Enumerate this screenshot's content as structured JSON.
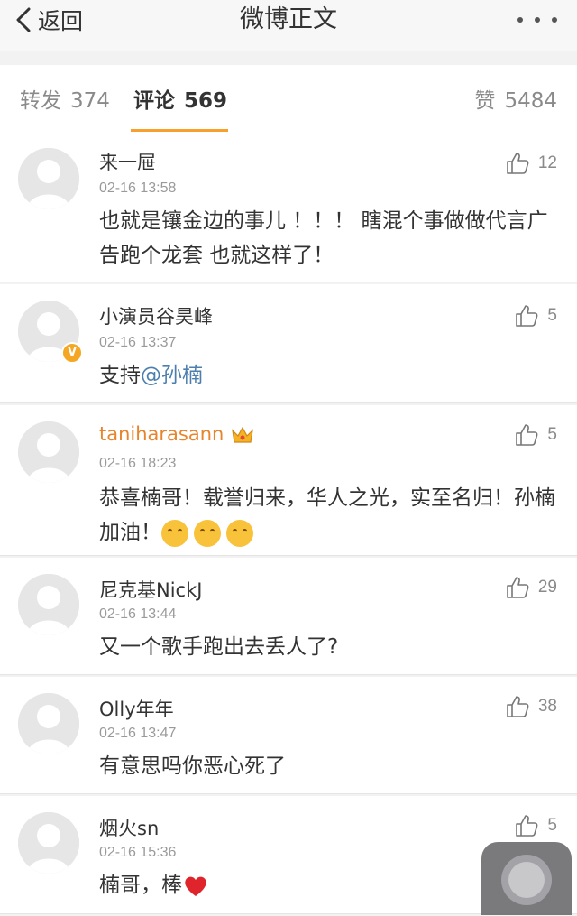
{
  "header": {
    "back_label": "返回",
    "title": "微博正文"
  },
  "tabs": {
    "repost": {
      "label": "转发",
      "count": "374"
    },
    "comment": {
      "label": "评论",
      "count": "569"
    },
    "like": {
      "label": "赞",
      "count": "5484"
    }
  },
  "colors": {
    "accent": "#f7a02c",
    "link": "#4d7fae",
    "vip_name": "#e8842c"
  },
  "comments": [
    {
      "name": "来一屉",
      "time": "02-16 13:58",
      "likes": "12",
      "text": "也就是镶金边的事儿 ！！！ 瞎混个事做做代言广告跑个龙套 也就这样了！"
    },
    {
      "name": "小演员谷昊峰",
      "time": "02-16 13:37",
      "likes": "5",
      "text_prefix": "支持",
      "mention": "@孙楠",
      "verified": "V"
    },
    {
      "name": "taniharasann",
      "time": "02-16 18:23",
      "likes": "5",
      "text": "恭喜楠哥！载誉归来，华人之光，实至名归！孙楠加油！"
    },
    {
      "name": "尼克基NickJ",
      "time": "02-16 13:44",
      "likes": "29",
      "text": "又一个歌手跑出去丢人了?"
    },
    {
      "name": "Olly年年",
      "time": "02-16 13:47",
      "likes": "38",
      "text": "有意思吗你恶心死了"
    },
    {
      "name": "烟火sn",
      "time": "02-16 15:36",
      "likes": "5",
      "text": "楠哥，棒"
    }
  ]
}
